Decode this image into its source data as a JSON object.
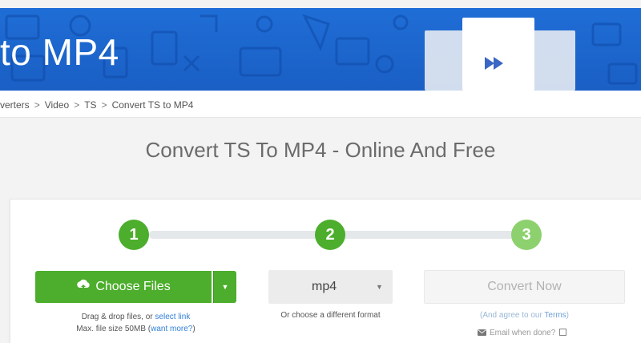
{
  "banner": {
    "title": "to MP4"
  },
  "breadcrumb": {
    "items": [
      "verters",
      "Video",
      "TS",
      "Convert TS to MP4"
    ],
    "separator": ">"
  },
  "page_title": "Convert TS To MP4 - Online And Free",
  "steps": [
    "1",
    "2",
    "3"
  ],
  "upload": {
    "button_label": "Choose Files",
    "hint_line1_prefix": "Drag & drop files, or ",
    "hint_link": "select link",
    "hint_line2_prefix": "Max. file size 50MB (",
    "hint_more_link": "want more?",
    "hint_line2_suffix": ")"
  },
  "format": {
    "selected": "mp4",
    "hint": "Or choose a different format"
  },
  "convert": {
    "button_label": "Convert Now",
    "terms_prefix": "(And agree to our ",
    "terms_link": "Terms",
    "terms_suffix": ")",
    "email_label": "Email when done?"
  },
  "colors": {
    "banner_blue": "#1a63cf",
    "green": "#4cae2c",
    "green_light": "#8dd16e",
    "link_blue": "#2f7ed8"
  },
  "icons": [
    "upload-cloud-icon",
    "chevron-down-icon",
    "play-forward-icon",
    "mail-icon"
  ]
}
